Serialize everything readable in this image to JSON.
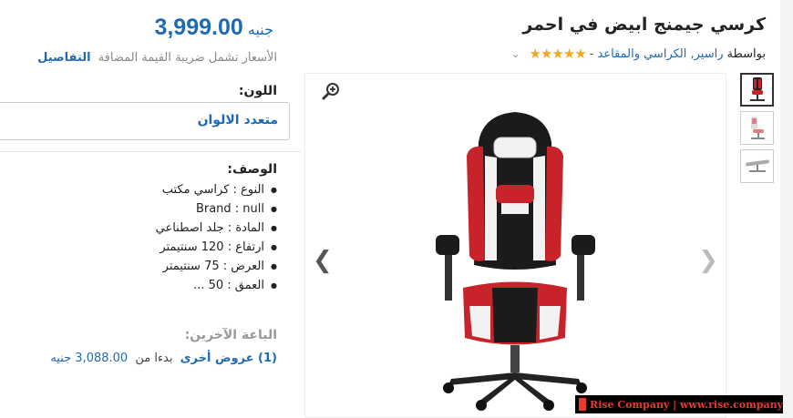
{
  "product": {
    "title": "كرسي جيمنج ابيض في احمر",
    "by_label": "بواسطة",
    "brand_link": "راسير, الكراسي والمقاعد",
    "dash": "-",
    "stars": "★★★★★",
    "rating_fraction": 1.0
  },
  "price": {
    "amount": "3,999.00",
    "currency": "جنيه",
    "vat_note": "الأسعار تشمل ضريبة القيمة المضافة",
    "details_link": "التفاصيل"
  },
  "color": {
    "label": "اللون:",
    "selected": "متعدد الالوان"
  },
  "description": {
    "label": "الوصف:",
    "items": [
      "النوع : كراسي مكتب",
      "Brand : null",
      "المادة : جلد اصطناعي",
      "ارتفاع : 120 سنتيمتر",
      "العرض : 75 سنتيمتر",
      "العمق : 50 ..."
    ]
  },
  "sellers": {
    "label": "الباعة الآخرين:",
    "offers_link": "(1) عروض أخرى",
    "starting_from": "بدءا من",
    "starting_price": "3,088.00 جنيه"
  },
  "gallery": {
    "zoom_icon": "magnifier-plus-icon",
    "prev_icon": "chevron-left-icon",
    "next_icon": "chevron-right-icon"
  },
  "watermark": {
    "text": "Rise Company | www.rise.company"
  },
  "colors": {
    "link_blue": "#1e6ab5",
    "star": "#f5a623",
    "watermark_red": "#e83a2e"
  }
}
